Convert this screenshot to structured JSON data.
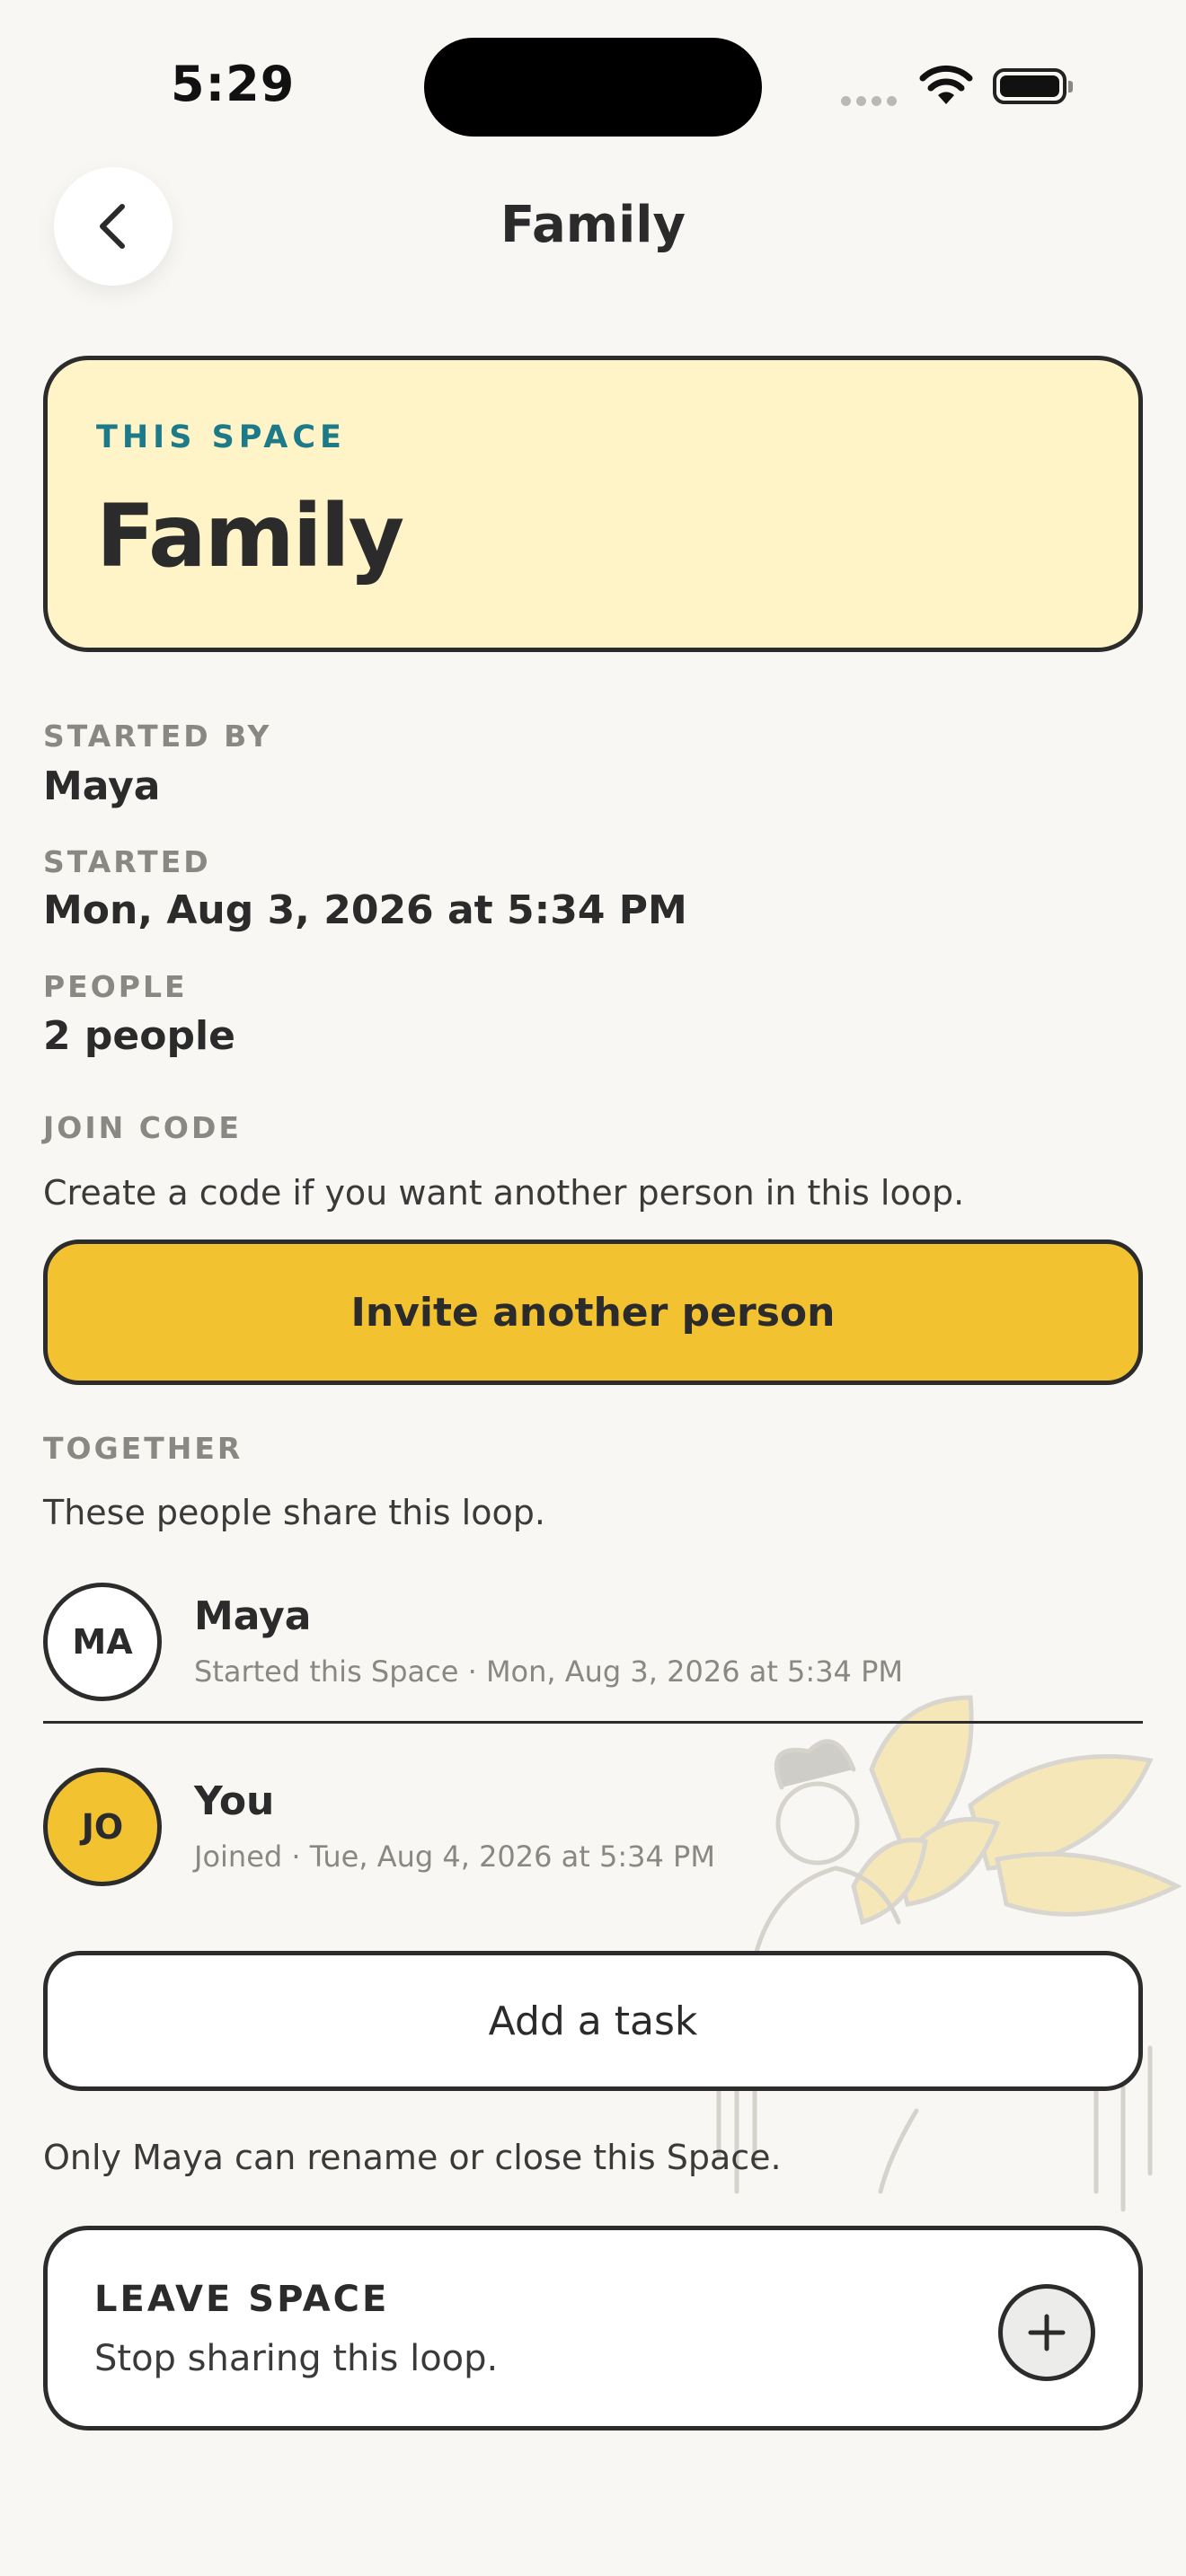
{
  "status_bar": {
    "time": "5:29"
  },
  "header": {
    "title": "Family"
  },
  "space_card": {
    "eyebrow": "THIS SPACE",
    "name": "Family"
  },
  "details": {
    "started_by_label": "STARTED BY",
    "started_by_value": "Maya",
    "started_label": "STARTED",
    "started_value": "Mon, Aug 3, 2026 at 5:34 PM",
    "people_label": "PEOPLE",
    "people_value": "2 people"
  },
  "join_code": {
    "label": "JOIN CODE",
    "description": "Create a code if you want another person in this loop.",
    "button_label": "Invite another person"
  },
  "together": {
    "label": "TOGETHER",
    "description": "These people share this loop.",
    "members": [
      {
        "initials": "MA",
        "name": "Maya",
        "detail": "Started this Space · Mon, Aug 3, 2026 at 5:34 PM",
        "avatar_color": "#ffffff"
      },
      {
        "initials": "JO",
        "name": "You",
        "detail": "Joined · Tue, Aug 4, 2026 at 5:34 PM",
        "avatar_color": "#f3c231"
      }
    ]
  },
  "actions": {
    "add_task_label": "Add a task",
    "owner_note": "Only Maya can rename or close this Space."
  },
  "leave_space": {
    "title": "LEAVE SPACE",
    "subtitle": "Stop sharing this loop.",
    "icon": "plus-icon"
  },
  "colors": {
    "background": "#f8f7f3",
    "space_card_bg": "#fff3c8",
    "accent_yellow": "#f3c231",
    "eyebrow_teal": "#1d7a89",
    "muted_label": "#8a8883"
  }
}
